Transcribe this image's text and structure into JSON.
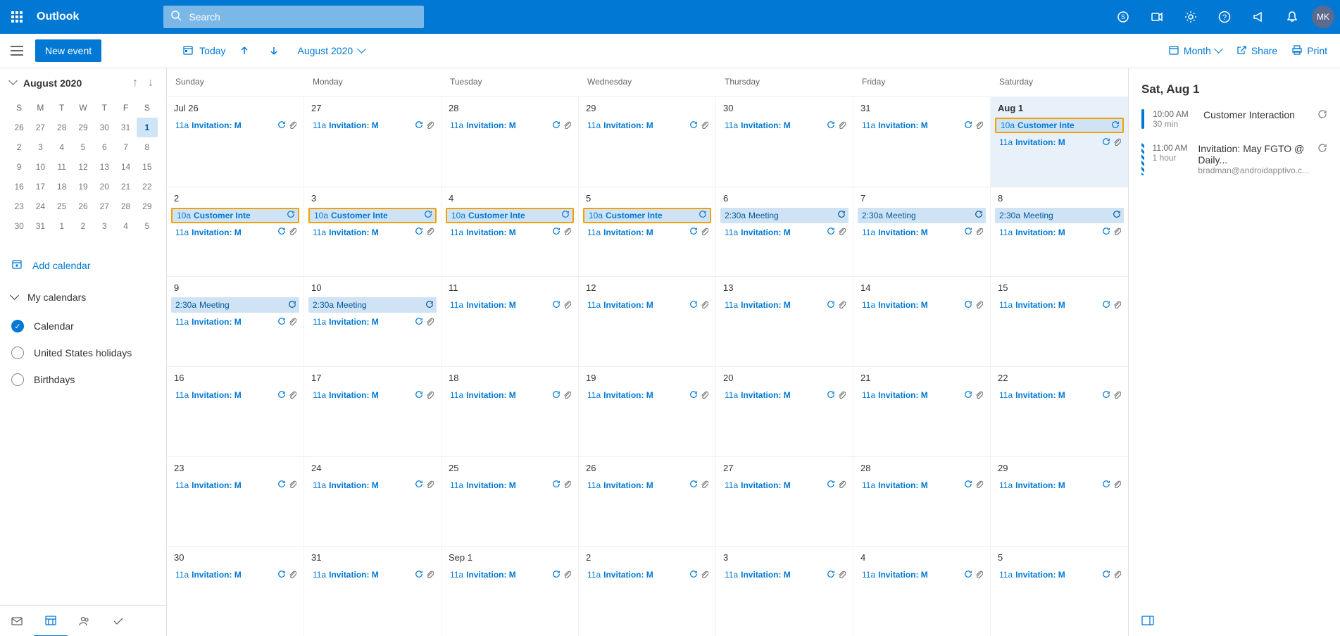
{
  "brand": "Outlook",
  "search": {
    "placeholder": "Search"
  },
  "avatar": "MK",
  "cmd": {
    "new_event": "New event",
    "today": "Today",
    "month_label": "August 2020",
    "view": "Month",
    "share": "Share",
    "print": "Print"
  },
  "mini": {
    "label": "August 2020",
    "dow": [
      "S",
      "M",
      "T",
      "W",
      "T",
      "F",
      "S"
    ],
    "rows": [
      [
        "26",
        "27",
        "28",
        "29",
        "30",
        "31",
        "1"
      ],
      [
        "2",
        "3",
        "4",
        "5",
        "6",
        "7",
        "8"
      ],
      [
        "9",
        "10",
        "11",
        "12",
        "13",
        "14",
        "15"
      ],
      [
        "16",
        "17",
        "18",
        "19",
        "20",
        "21",
        "22"
      ],
      [
        "23",
        "24",
        "25",
        "26",
        "27",
        "28",
        "29"
      ],
      [
        "30",
        "31",
        "1",
        "2",
        "3",
        "4",
        "5"
      ]
    ],
    "selected": "1"
  },
  "add_calendar": "Add calendar",
  "my_calendars": "My calendars",
  "calendars": [
    {
      "name": "Calendar",
      "checked": true
    },
    {
      "name": "United States holidays",
      "checked": false
    },
    {
      "name": "Birthdays",
      "checked": false
    }
  ],
  "dow_full": [
    "Sunday",
    "Monday",
    "Tuesday",
    "Wednesday",
    "Thursday",
    "Friday",
    "Saturday"
  ],
  "event_labels": {
    "inv_time": "11a",
    "inv_title": "Invitation: M",
    "cust_time": "10a",
    "cust_title": "Customer Inte",
    "meet_time": "2:30a",
    "meet_title": "Meeting"
  },
  "weeks": [
    {
      "days": [
        {
          "num": "Jul 26",
          "events": [
            {
              "type": "inv"
            }
          ]
        },
        {
          "num": "27",
          "events": [
            {
              "type": "inv"
            }
          ]
        },
        {
          "num": "28",
          "events": [
            {
              "type": "inv"
            }
          ]
        },
        {
          "num": "29",
          "events": [
            {
              "type": "inv"
            }
          ]
        },
        {
          "num": "30",
          "events": [
            {
              "type": "inv"
            }
          ]
        },
        {
          "num": "31",
          "events": [
            {
              "type": "inv"
            }
          ]
        },
        {
          "num": "Aug 1",
          "today": true,
          "events": [
            {
              "type": "cust_o"
            },
            {
              "type": "inv"
            }
          ]
        }
      ]
    },
    {
      "days": [
        {
          "num": "2",
          "events": [
            {
              "type": "cust_o"
            },
            {
              "type": "inv"
            }
          ]
        },
        {
          "num": "3",
          "events": [
            {
              "type": "cust_o"
            },
            {
              "type": "inv"
            }
          ]
        },
        {
          "num": "4",
          "events": [
            {
              "type": "cust_o"
            },
            {
              "type": "inv"
            }
          ]
        },
        {
          "num": "5",
          "events": [
            {
              "type": "cust_o"
            },
            {
              "type": "inv"
            }
          ]
        },
        {
          "num": "6",
          "events": [
            {
              "type": "meet"
            },
            {
              "type": "inv"
            }
          ]
        },
        {
          "num": "7",
          "events": [
            {
              "type": "meet"
            },
            {
              "type": "inv"
            }
          ]
        },
        {
          "num": "8",
          "events": [
            {
              "type": "meet"
            },
            {
              "type": "inv"
            }
          ]
        }
      ]
    },
    {
      "days": [
        {
          "num": "9",
          "events": [
            {
              "type": "meet"
            },
            {
              "type": "inv"
            }
          ]
        },
        {
          "num": "10",
          "events": [
            {
              "type": "meet"
            },
            {
              "type": "inv"
            }
          ]
        },
        {
          "num": "11",
          "events": [
            {
              "type": "inv"
            }
          ]
        },
        {
          "num": "12",
          "events": [
            {
              "type": "inv"
            }
          ]
        },
        {
          "num": "13",
          "events": [
            {
              "type": "inv"
            }
          ]
        },
        {
          "num": "14",
          "events": [
            {
              "type": "inv"
            }
          ]
        },
        {
          "num": "15",
          "events": [
            {
              "type": "inv"
            }
          ]
        }
      ]
    },
    {
      "days": [
        {
          "num": "16",
          "events": [
            {
              "type": "inv"
            }
          ]
        },
        {
          "num": "17",
          "events": [
            {
              "type": "inv"
            }
          ]
        },
        {
          "num": "18",
          "events": [
            {
              "type": "inv"
            }
          ]
        },
        {
          "num": "19",
          "events": [
            {
              "type": "inv"
            }
          ]
        },
        {
          "num": "20",
          "events": [
            {
              "type": "inv"
            }
          ]
        },
        {
          "num": "21",
          "events": [
            {
              "type": "inv"
            }
          ]
        },
        {
          "num": "22",
          "events": [
            {
              "type": "inv"
            }
          ]
        }
      ]
    },
    {
      "days": [
        {
          "num": "23",
          "events": [
            {
              "type": "inv"
            }
          ]
        },
        {
          "num": "24",
          "events": [
            {
              "type": "inv"
            }
          ]
        },
        {
          "num": "25",
          "events": [
            {
              "type": "inv"
            }
          ]
        },
        {
          "num": "26",
          "events": [
            {
              "type": "inv"
            }
          ]
        },
        {
          "num": "27",
          "events": [
            {
              "type": "inv"
            }
          ]
        },
        {
          "num": "28",
          "events": [
            {
              "type": "inv"
            }
          ]
        },
        {
          "num": "29",
          "events": [
            {
              "type": "inv"
            }
          ]
        }
      ]
    },
    {
      "days": [
        {
          "num": "30",
          "events": [
            {
              "type": "inv"
            }
          ]
        },
        {
          "num": "31",
          "events": [
            {
              "type": "inv"
            }
          ]
        },
        {
          "num": "Sep 1",
          "events": [
            {
              "type": "inv"
            }
          ]
        },
        {
          "num": "2",
          "events": [
            {
              "type": "inv"
            }
          ]
        },
        {
          "num": "3",
          "events": [
            {
              "type": "inv"
            }
          ]
        },
        {
          "num": "4",
          "events": [
            {
              "type": "inv"
            }
          ]
        },
        {
          "num": "5",
          "events": [
            {
              "type": "inv"
            }
          ]
        }
      ]
    }
  ],
  "agenda": {
    "heading": "Sat, Aug 1",
    "items": [
      {
        "time": "10:00 AM",
        "title": "Customer Interaction",
        "sub": "30 min",
        "bar": "solid"
      },
      {
        "time": "11:00 AM",
        "title": "Invitation: May FGTO @ Daily...",
        "sub": "1 hour    bradman@androidapptivo.c...",
        "bar": "hatched"
      }
    ]
  }
}
